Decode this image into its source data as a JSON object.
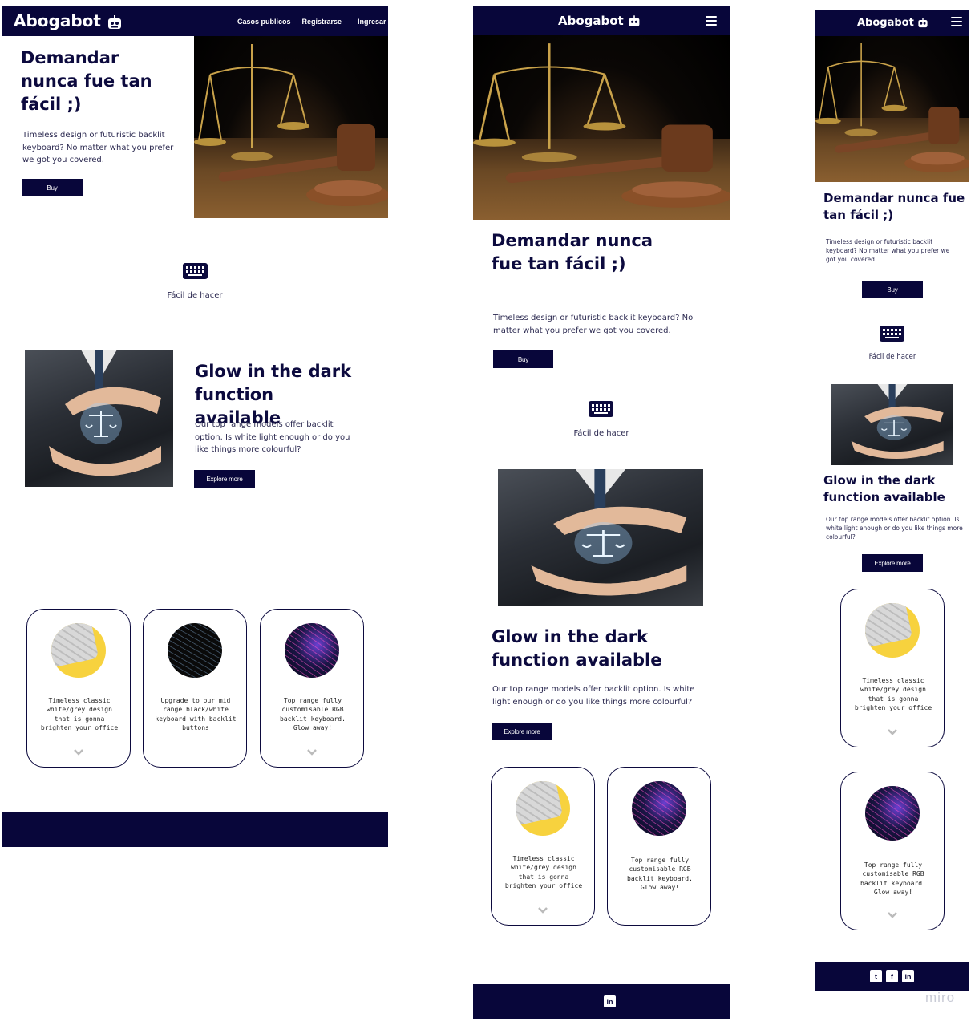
{
  "brand": {
    "name": "Abogabot",
    "logo_icon": "robot-icon"
  },
  "nav": {
    "links": [
      "Casos publicos",
      "Registrarse",
      "Ingresar"
    ],
    "menu_icon": "hamburger-menu-icon"
  },
  "hero": {
    "title": "Demandar nunca fue tan fácil ;)",
    "description": "Timeless design or futuristic backlit keyboard? No matter what you prefer we got you covered.",
    "button": "Buy",
    "image": "scales-of-justice-gavel-photo"
  },
  "feature": {
    "icon": "keyboard-icon",
    "label": "Fácil de hacer"
  },
  "glow": {
    "title": "Glow in the dark function available",
    "description": "Our top range models offer backlit option. Is white light enough or do you like things more colourful?",
    "button": "Explore more",
    "image": "hands-holding-scales-photo"
  },
  "cards": [
    {
      "text": "Timeless classic white/grey design that is gonna brighten your office",
      "image": "white-keyboard-yellow"
    },
    {
      "text": "Upgrade to our mid range black/white keyboard with backlit buttons",
      "image": "black-keyboard"
    },
    {
      "text": "Top range fully customisable RGB backlit keyboard. Glow away!",
      "image": "rgb-keyboard"
    }
  ],
  "footer": {
    "social_icons": [
      "twitter-icon",
      "facebook-icon",
      "linkedin-icon"
    ],
    "social_glyphs": [
      "t",
      "f",
      "in"
    ]
  },
  "watermark": "miro",
  "colors": {
    "navy": "#08063a",
    "text": "#0c0a3e",
    "yellow": "#f7d23e"
  }
}
